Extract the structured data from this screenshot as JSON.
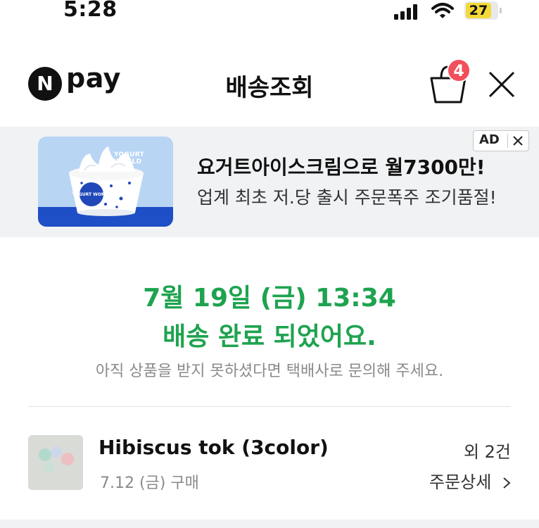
{
  "status_bar": {
    "time": "5:28",
    "battery": "27"
  },
  "header": {
    "logo_letter": "N",
    "logo_text": "pay",
    "title": "배송조회",
    "cart_count": "4"
  },
  "ad": {
    "image_label": "YOGURT WORLD",
    "cup_label": "YOGURT WORLD",
    "title": "요거트아이스크림으로 월7300만!",
    "subtitle": "업계 최초 저.당 출시 주문폭주 조기품절!",
    "tag": "AD"
  },
  "delivery": {
    "date": "7월 19일 (금) 13:34",
    "message": "배송 완료 되었어요.",
    "note": "아직 상품을 받지 못하셨다면 택배사로 문의해 주세요."
  },
  "order": {
    "product_name": "Hibiscus tok (3color)",
    "purchase_date": "7.12 (금) 구매",
    "count_label": "외 2건",
    "detail_label": "주문상세"
  },
  "colors": {
    "accent_green": "#1ea34f",
    "badge_red": "#f04f5b"
  },
  "icons": [
    "signal-icon",
    "wifi-icon",
    "battery-icon",
    "cart-icon",
    "close-icon",
    "chevron-right-icon"
  ]
}
